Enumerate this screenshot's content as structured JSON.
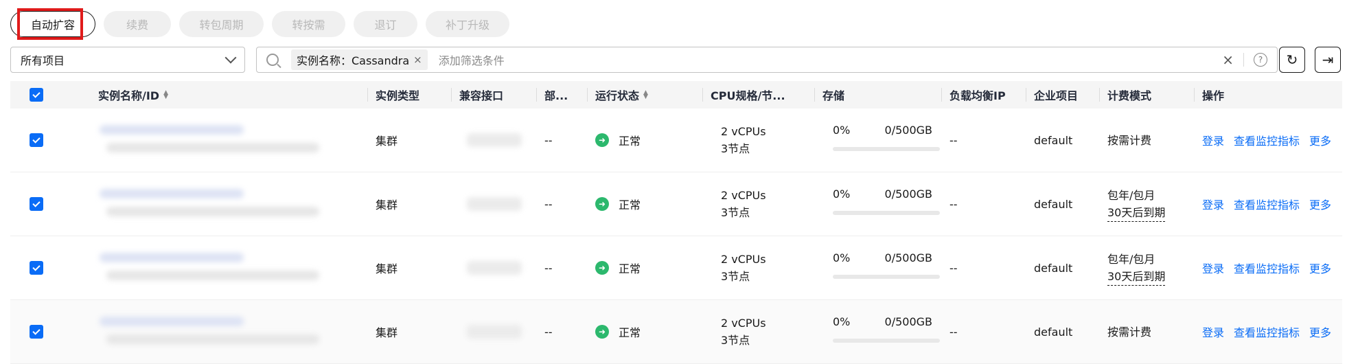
{
  "toolbar": {
    "auto_scale": "自动扩容",
    "renew": "续费",
    "to_yearly": "转包周期",
    "to_ondemand": "转按需",
    "unsubscribe": "退订",
    "patch_upgrade": "补丁升级"
  },
  "filter": {
    "project_select": "所有项目",
    "chip_label": "实例名称：Cassandra",
    "chip_close": "×",
    "add_condition": "添加筛选条件",
    "clear": "×",
    "help": "?"
  },
  "actions": {
    "refresh_icon": "↻",
    "export_icon": "⇥"
  },
  "table": {
    "headers": {
      "name": "实例名称/ID",
      "type": "实例类型",
      "port": "兼容接口",
      "dept": "部...",
      "status": "运行状态",
      "cpu": "CPU规格/节...",
      "storage": "存储",
      "lb": "负载均衡IP",
      "project": "企业项目",
      "billing": "计费模式",
      "ops": "操作"
    },
    "rows": [
      {
        "type": "集群",
        "dept": "--",
        "status": "正常",
        "cpu_1": "2 vCPUs",
        "cpu_2": "3节点",
        "storage_pct": "0%",
        "storage_cap": "0/500GB",
        "storage_used": 0,
        "lb": "--",
        "project": "default",
        "billing_1": "按需计费",
        "billing_2": "",
        "op_login": "登录",
        "op_metrics": "查看监控指标",
        "op_more": "更多"
      },
      {
        "type": "集群",
        "dept": "--",
        "status": "正常",
        "cpu_1": "2 vCPUs",
        "cpu_2": "3节点",
        "storage_pct": "0%",
        "storage_cap": "0/500GB",
        "storage_used": 0,
        "lb": "--",
        "project": "default",
        "billing_1": "包年/包月",
        "billing_2": "30天后到期",
        "op_login": "登录",
        "op_metrics": "查看监控指标",
        "op_more": "更多"
      },
      {
        "type": "集群",
        "dept": "--",
        "status": "正常",
        "cpu_1": "2 vCPUs",
        "cpu_2": "3节点",
        "storage_pct": "0%",
        "storage_cap": "0/500GB",
        "storage_used": 0,
        "lb": "--",
        "project": "default",
        "billing_1": "包年/包月",
        "billing_2": "30天后到期",
        "op_login": "登录",
        "op_metrics": "查看监控指标",
        "op_more": "更多"
      },
      {
        "type": "集群",
        "dept": "--",
        "status": "正常",
        "cpu_1": "2 vCPUs",
        "cpu_2": "3节点",
        "storage_pct": "0%",
        "storage_cap": "0/500GB",
        "storage_used": 0,
        "lb": "--",
        "project": "default",
        "billing_1": "按需计费",
        "billing_2": "",
        "op_login": "登录",
        "op_metrics": "查看监控指标",
        "op_more": "更多"
      }
    ]
  },
  "colors": {
    "accent": "#0a6cf6",
    "status_ok": "#2cb86d",
    "highlight": "#e01b1b"
  }
}
